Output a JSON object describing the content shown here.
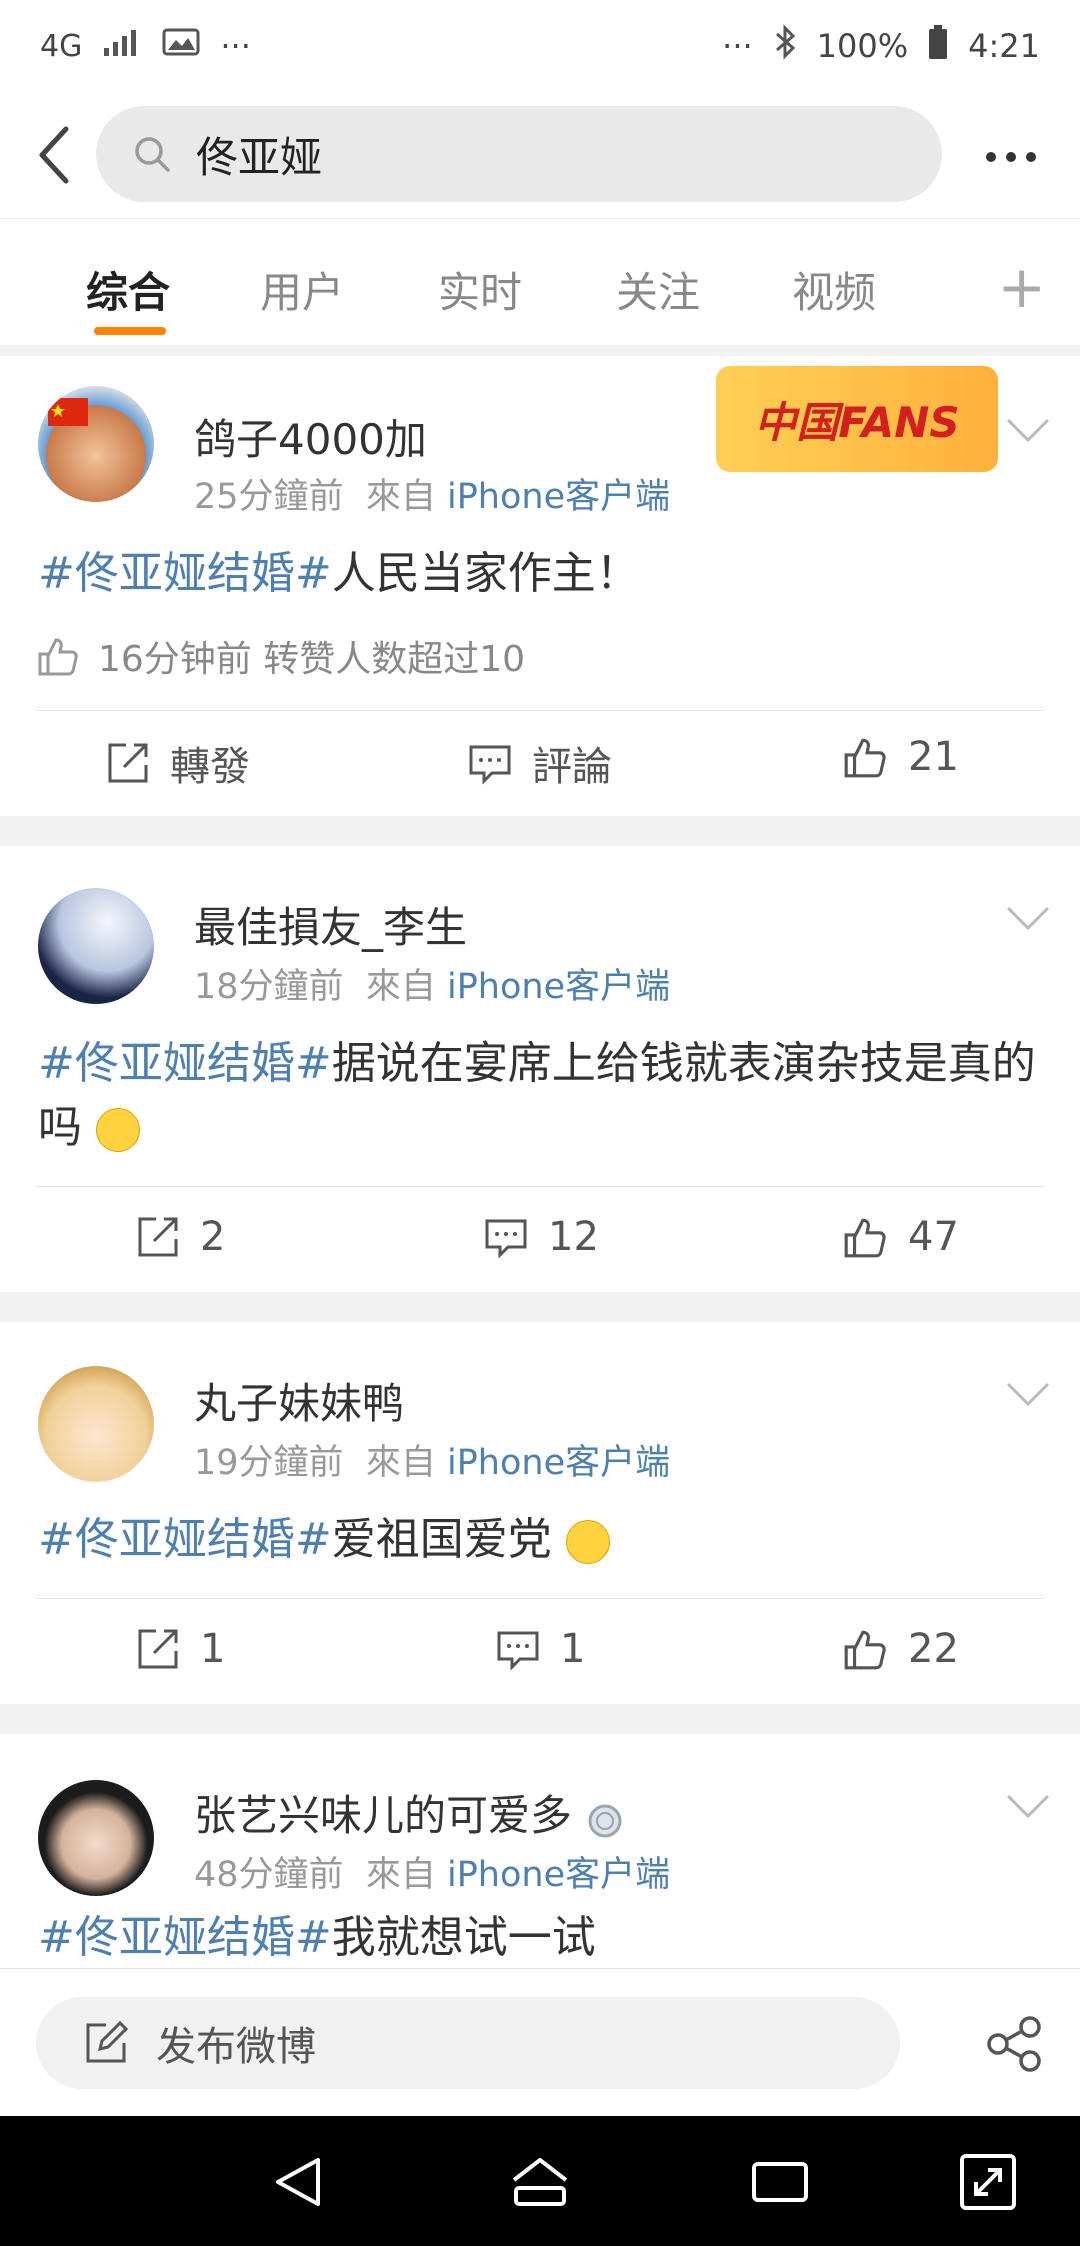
{
  "status_bar": {
    "network": "4G",
    "battery": "100%",
    "time": "4:21",
    "dots": "···"
  },
  "search": {
    "query": "佟亚娅"
  },
  "tabs": [
    "综合",
    "用户",
    "实时",
    "关注",
    "视频"
  ],
  "posts": [
    {
      "user": "鸽子4000加",
      "time": "25分鐘前",
      "from_label": "來自",
      "source": "iPhone客户端",
      "tag": "#佟亚娅结婚#",
      "text": "人民当家作主！",
      "badge": "中国FANS",
      "liked_note": "16分钟前 转赞人数超过10",
      "actions": {
        "repost": "轉發",
        "comment": "評論",
        "like": "21"
      }
    },
    {
      "user": "最佳損友_李生",
      "time": "18分鐘前",
      "from_label": "來自",
      "source": "iPhone客户端",
      "tag": "#佟亚娅结婚#",
      "text": "据说在宴席上给钱就表演杂技是真的吗",
      "actions": {
        "repost": "2",
        "comment": "12",
        "like": "47"
      }
    },
    {
      "user": "丸子妹妹鸭",
      "time": "19分鐘前",
      "from_label": "來自",
      "source": "iPhone客户端",
      "tag": "#佟亚娅结婚#",
      "text": "爱祖国爱党",
      "actions": {
        "repost": "1",
        "comment": "1",
        "like": "22"
      }
    },
    {
      "user": "张艺兴味儿的可爱多",
      "time": "48分鐘前",
      "from_label": "來自",
      "source": "iPhone客户端",
      "tag": "#佟亚娅结婚#",
      "text": "我就想试一试"
    }
  ],
  "composer": {
    "label": "发布微博"
  },
  "colors": {
    "accent": "#ff8200",
    "link": "#4d7fb0"
  }
}
